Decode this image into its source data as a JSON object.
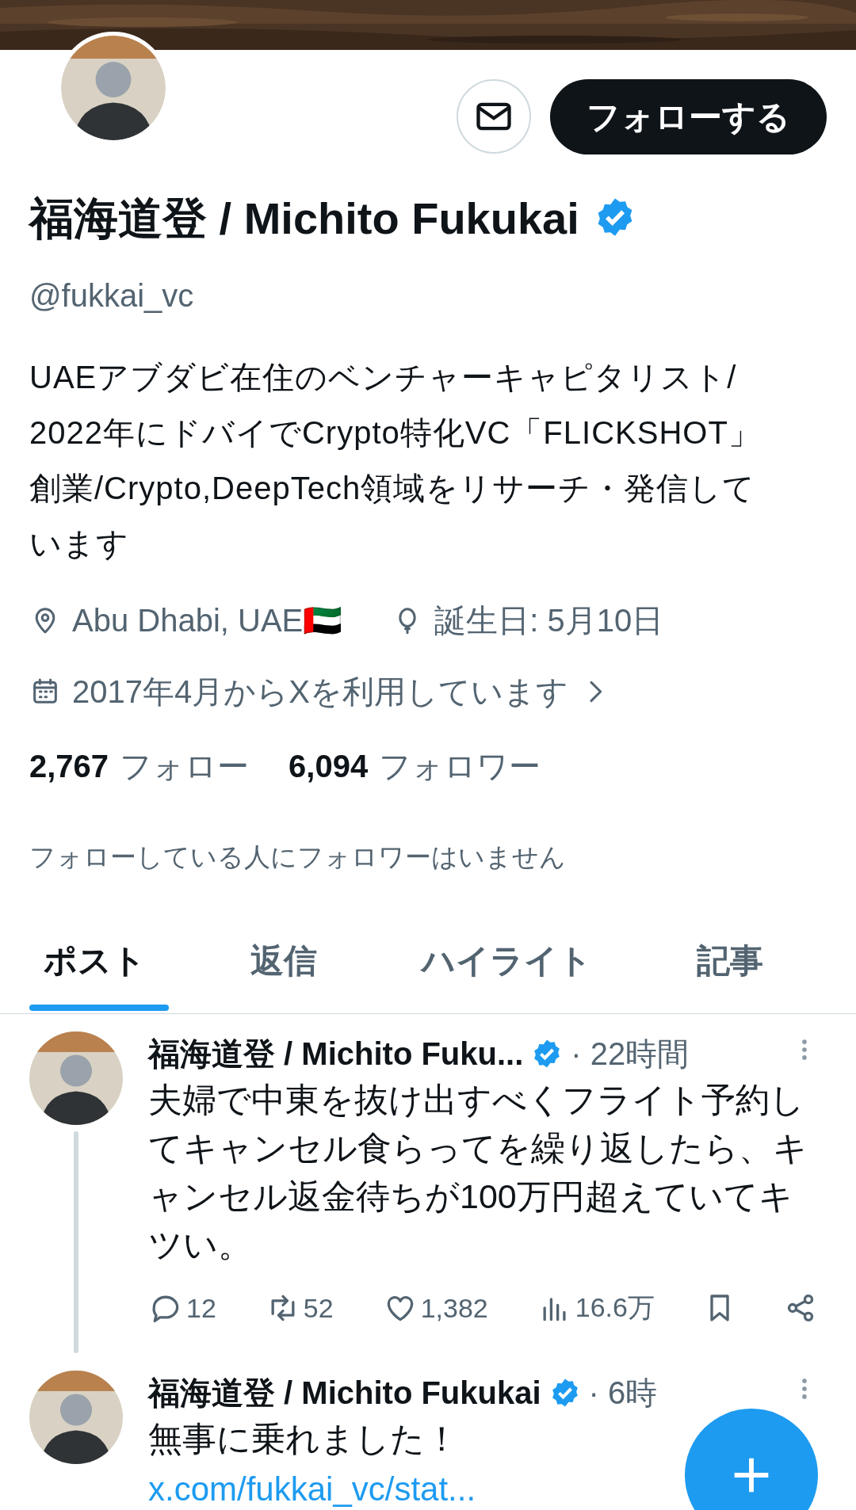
{
  "profile": {
    "follow_button": "フォローする",
    "name": "福海道登 / Michito Fukukai",
    "verified": true,
    "handle": "@fukkai_vc",
    "bio_lines": [
      "UAEアブダビ在住のベンチャーキャピタリスト/",
      "2022年にドバイでCrypto特化VC「FLICKSHOT」",
      "創業/Crypto,DeepTech領域をリサーチ・発信して",
      "います"
    ],
    "location": "Abu Dhabi, UAE🇦🇪",
    "birthday": "誕生日: 5月10日",
    "joined": "2017年4月からXを利用しています",
    "following_count": "2,767",
    "following_label": "フォロー",
    "followers_count": "6,094",
    "followers_label": "フォロワー",
    "mutual_note": "フォローしている人にフォロワーはいません"
  },
  "tabs": [
    {
      "label": "ポスト",
      "selected": true
    },
    {
      "label": "返信",
      "selected": false
    },
    {
      "label": "ハイライト",
      "selected": false
    },
    {
      "label": "記事",
      "selected": false
    }
  ],
  "posts": [
    {
      "author": "福海道登 / Michito Fuku...",
      "verified": true,
      "time": "· 22時間",
      "thread": true,
      "text": "夫婦で中東を抜け出すべくフライト予約してキャンセル食らってを繰り返したら、キャンセル返金待ちが100万円超えていてキツい。",
      "stats": {
        "replies": "12",
        "reposts": "52",
        "likes": "1,382",
        "views": "16.6万"
      }
    },
    {
      "author": "福海道登 / Michito Fukukai",
      "verified": true,
      "time": "· 6時",
      "thread": false,
      "text": "無事に乗れました！",
      "link": "x.com/fukkai_vc/stat..."
    }
  ]
}
